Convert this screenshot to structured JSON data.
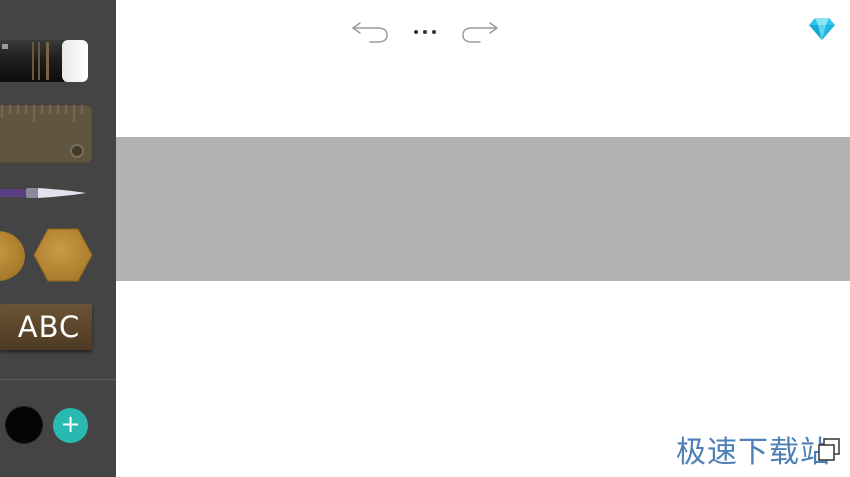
{
  "toolbar": {
    "undo_icon": "undo-arrow-icon",
    "more_icon": "ellipsis-icon",
    "redo_icon": "redo-arrow-icon",
    "premium_icon": "diamond-icon"
  },
  "sidebar": {
    "tools": [
      {
        "name": "eraser",
        "icon": "eraser-icon"
      },
      {
        "name": "ruler",
        "icon": "ruler-icon"
      },
      {
        "name": "brush",
        "icon": "paintbrush-icon"
      },
      {
        "name": "circle",
        "icon": "circle-shape-icon"
      },
      {
        "name": "hexagon",
        "icon": "hexagon-shape-icon"
      }
    ],
    "text_tool_label": "ABC",
    "current_color": "#050505",
    "add_color_label": "+"
  },
  "colors": {
    "sidebar_bg": "#444444",
    "canvas_shape": "#b2b2b2",
    "accent": "#2ab9b0",
    "premium": "#2cc4e8",
    "shape_gold": "#b8862f"
  },
  "watermark": {
    "text": "极速下载站"
  }
}
